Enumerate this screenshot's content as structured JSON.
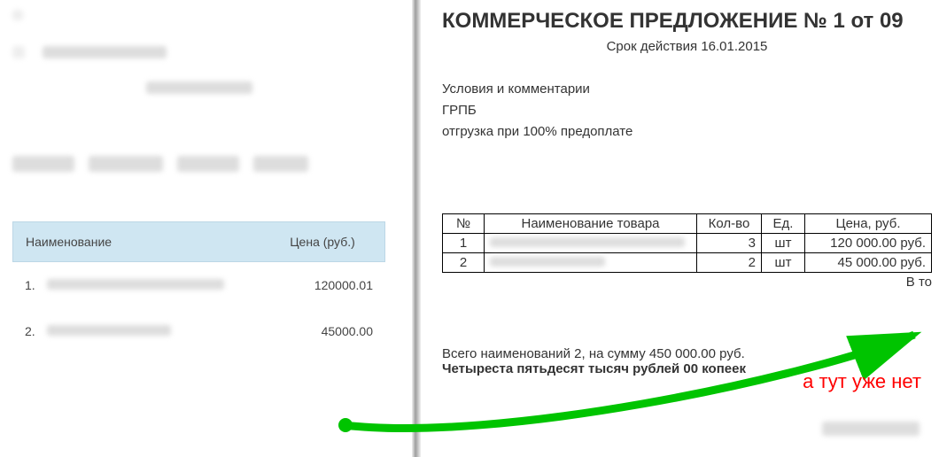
{
  "left": {
    "header_name": "Наименование",
    "header_price": "Цена (руб.)",
    "items": [
      {
        "idx": "1.",
        "price": "120000.01"
      },
      {
        "idx": "2.",
        "price": "45000.00"
      }
    ]
  },
  "doc": {
    "title": "КОММЕРЧЕСКОЕ ПРЕДЛОЖЕНИЕ № 1 от 09",
    "subtitle": "Срок действия 16.01.2015",
    "cond_label": "Условия и комментарии",
    "cond_line1": "ГРПБ",
    "cond_line2": "отгрузка при 100% предоплате",
    "tbl": {
      "h_no": "№",
      "h_name": "Наименование товара",
      "h_qty": "Кол-во",
      "h_unit": "Ед.",
      "h_price": "Цена, руб.",
      "rows": [
        {
          "no": "1",
          "qty": "3",
          "unit": "шт",
          "price": "120 000.00 руб."
        },
        {
          "no": "2",
          "qty": "2",
          "unit": "шт",
          "price": "45 000.00 руб."
        }
      ],
      "subtotal": "В то"
    },
    "sum_prefix": "Всего наименований ",
    "sum_mid": "2, на сумму 450 000.00 руб.",
    "sum_words": "Четыреста пятьдесят тысяч рублей 00 копеек",
    "annotation": "а тут уже нет"
  }
}
